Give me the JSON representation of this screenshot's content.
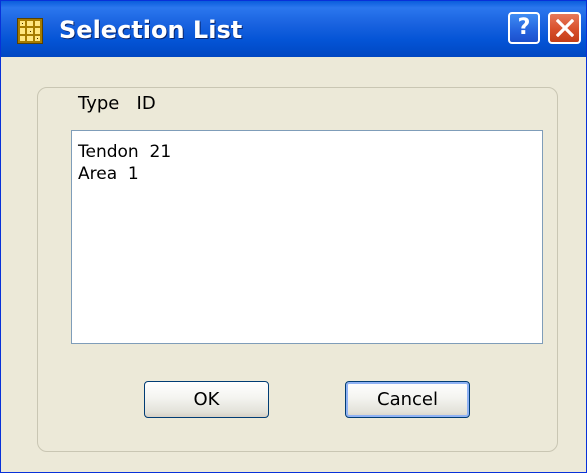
{
  "window": {
    "title": "Selection List",
    "icon": "grid-app-icon",
    "help_label": "?",
    "close_icon": "close-x-icon"
  },
  "list": {
    "header": "Type   ID",
    "items": [
      "Tendon  21",
      "Area  1"
    ]
  },
  "buttons": {
    "ok_label": "OK",
    "cancel_label": "Cancel"
  },
  "colors": {
    "titlebar": "#0454d6",
    "dialog_bg": "#ece9d8",
    "close_button": "#d8502b",
    "listbox_border": "#7f9db9"
  }
}
